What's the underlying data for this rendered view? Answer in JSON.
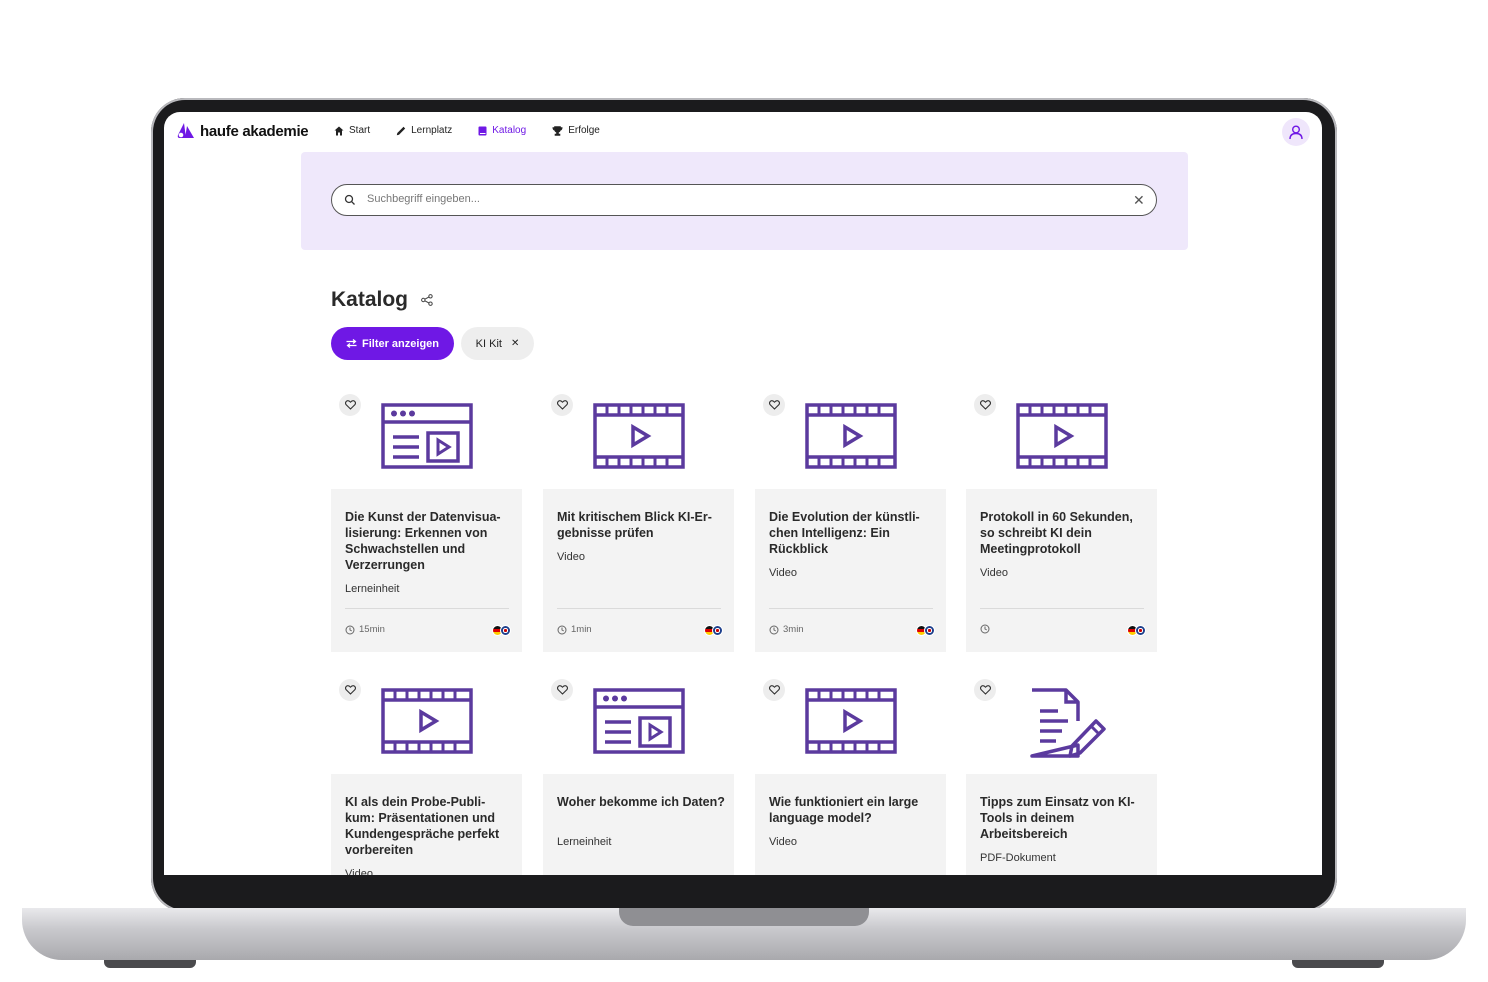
{
  "brand": {
    "name": "haufe akademie",
    "color": "#6f18e5"
  },
  "nav": [
    {
      "label": "Start",
      "icon": "home-icon",
      "active": false
    },
    {
      "label": "Lernplatz",
      "icon": "pencil-icon",
      "active": false
    },
    {
      "label": "Katalog",
      "icon": "book-icon",
      "active": true
    },
    {
      "label": "Erfolge",
      "icon": "trophy-icon",
      "active": false
    }
  ],
  "search": {
    "placeholder": "Suchbegriff eingeben...",
    "value": ""
  },
  "page": {
    "title": "Katalog"
  },
  "filters": {
    "button_label": "Filter anzeigen",
    "chips": [
      {
        "label": "KI Kit"
      }
    ]
  },
  "cards": [
    {
      "title": "Die Kunst der Datenvisua-lisierung: Erkennen von Schwachstellen und Verzerrungen",
      "type": "Lerneinheit",
      "duration": "15min",
      "illustration": "learning-unit-icon",
      "languages": [
        "de",
        "en"
      ]
    },
    {
      "title": "Mit kritischem Blick KI-Er-gebnisse prüfen",
      "type": "Video",
      "duration": "1min",
      "illustration": "video-icon",
      "languages": [
        "de",
        "en"
      ]
    },
    {
      "title": "Die Evolution der künstli-chen Intelligenz: Ein Rückblick",
      "type": "Video",
      "duration": "3min",
      "illustration": "video-icon",
      "languages": [
        "de",
        "en"
      ]
    },
    {
      "title": "Protokoll in 60 Sekunden, so schreibt KI dein Meetingprotokoll",
      "type": "Video",
      "duration": "",
      "illustration": "video-icon",
      "languages": [
        "de",
        "en"
      ]
    },
    {
      "title": "KI als dein Probe-Publi-kum: Präsentationen und Kundengespräche perfekt vorbereiten",
      "type": "Video",
      "duration": "",
      "illustration": "video-icon",
      "languages": []
    },
    {
      "title": "Woher bekomme ich Daten?",
      "type": "Lerneinheit",
      "duration": "",
      "illustration": "learning-unit-icon",
      "languages": []
    },
    {
      "title": "Wie funktioniert ein large language model?",
      "type": "Video",
      "duration": "",
      "illustration": "video-icon",
      "languages": []
    },
    {
      "title": "Tipps zum Einsatz von KI-Tools in deinem Arbeitsbereich",
      "type": "PDF-Dokument",
      "duration": "",
      "illustration": "document-icon",
      "languages": []
    }
  ]
}
